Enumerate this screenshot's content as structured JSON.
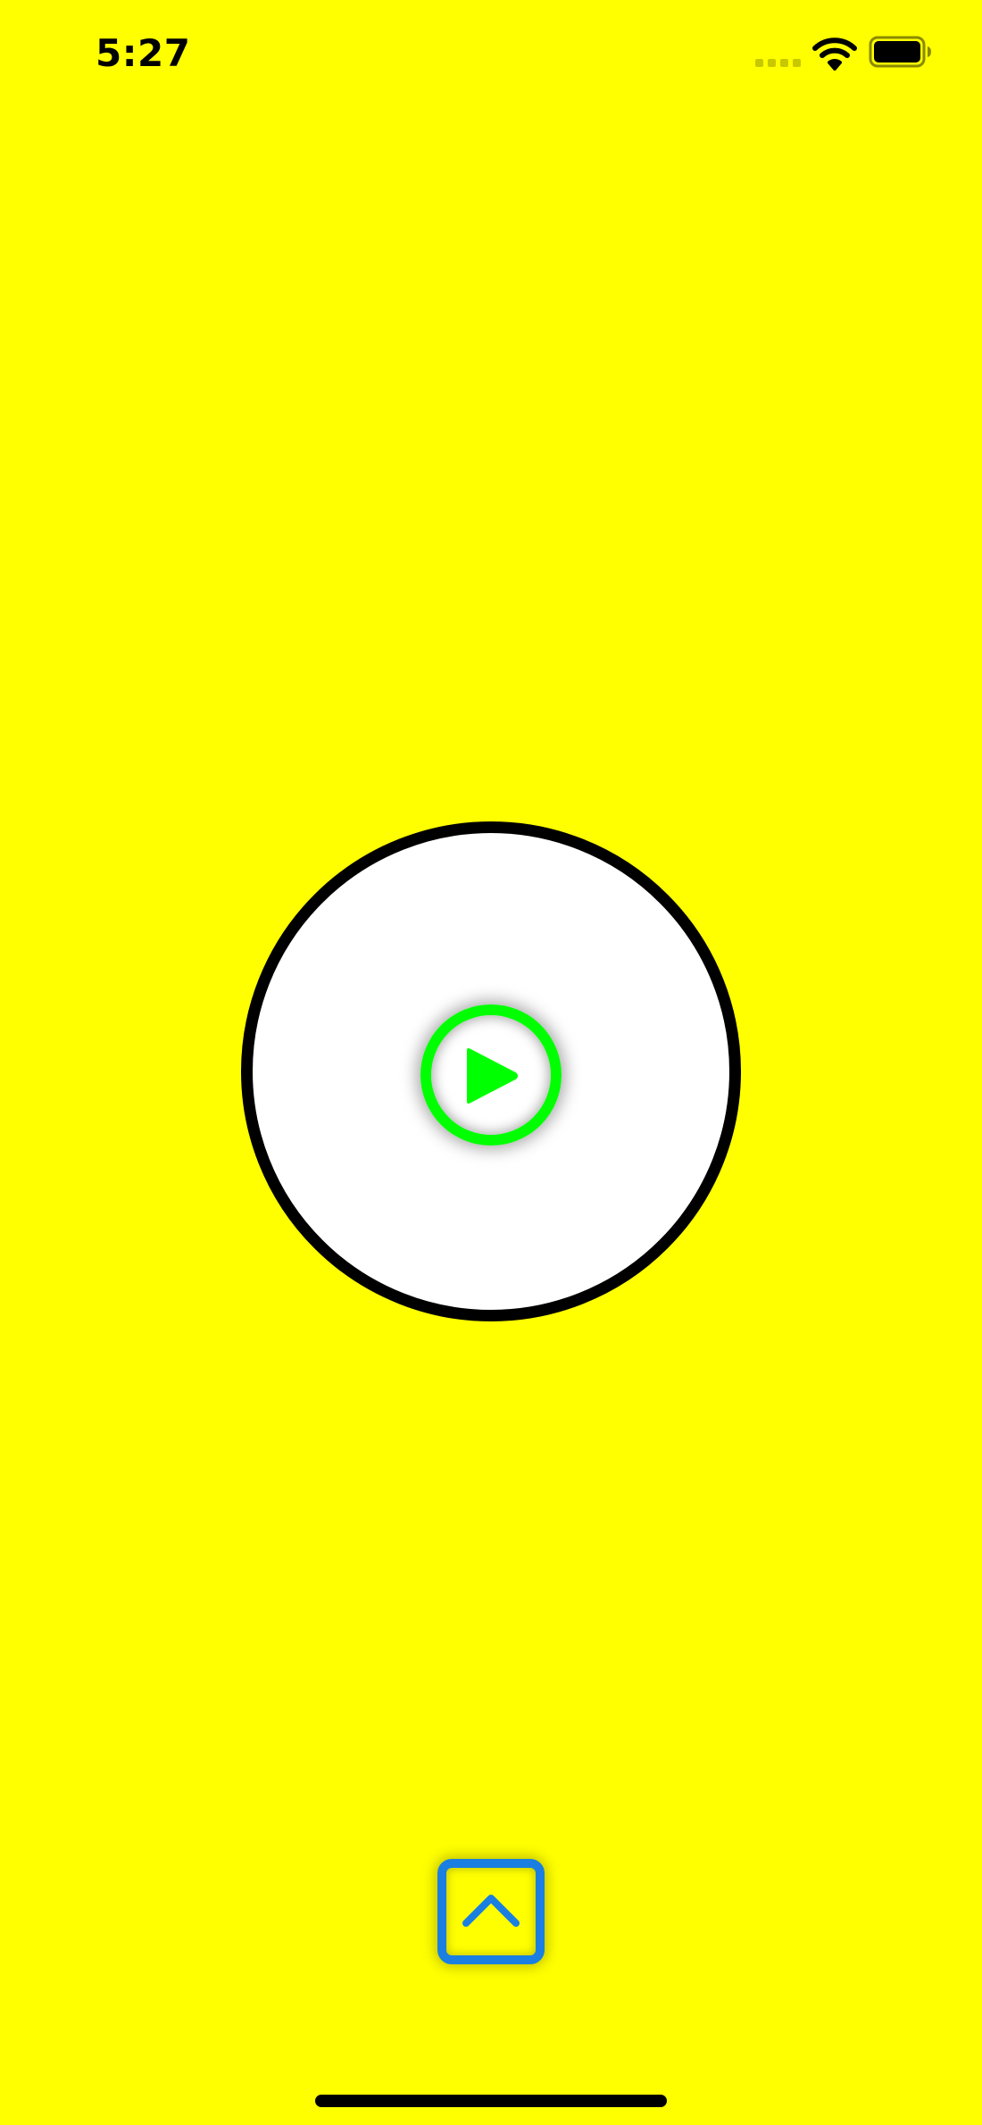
{
  "status_bar": {
    "time": "5:27"
  },
  "colors": {
    "background": "#ffff00",
    "circle_fill": "#ffffff",
    "circle_border": "#000000",
    "play_accent": "#00ff00",
    "expand_accent": "#1a7fe0"
  },
  "icons": {
    "signal": "cellular-signal-icon",
    "wifi": "wifi-icon",
    "battery": "battery-icon",
    "play": "play-icon",
    "expand": "chevron-up-icon"
  }
}
